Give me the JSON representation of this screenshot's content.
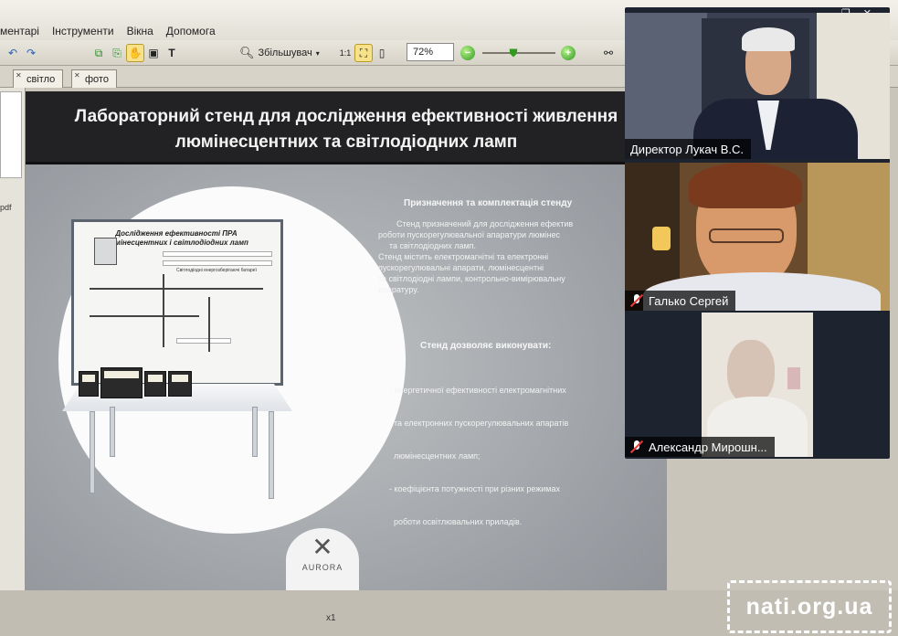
{
  "menu": {
    "items": [
      "ментарі",
      "Інструменти",
      "Вікна",
      "Допомога"
    ]
  },
  "toolbar": {
    "magnifier_label": "Збільшувач",
    "zoom_value": "72%"
  },
  "tabs": [
    {
      "label": "світло"
    },
    {
      "label": "фото"
    }
  ],
  "left_panel": {
    "file_label": "pdf"
  },
  "slide": {
    "title_line1": "Лабораторний стенд для дослідження ефективності живлення",
    "title_line2": "люмінесцентних та світлодіодних ламп",
    "board_title_line1": "Дослідження ефективності ПРА",
    "board_title_line2": "люмінесцентних і світлодіодних ламп",
    "board_sub": "Світлодіодні енергозберігаючі батареї",
    "section1_title": "Призначення та комплектація стенду",
    "section1_lines": [
      "Стенд призначений для дослідження ефектив",
      "роботи пускорегулювальної апаратури люмінес",
      "та світлодіодних ламп.",
      "Стенд містить електромагнітні та електронні",
      "пускорегулювальні апарати, люмінесцентні",
      "та світлодіодні лампи, контрольно-вимірювальну",
      "апаратуру."
    ],
    "section2_title": "Стенд дозволяє виконувати:",
    "section2_lines": [
      "- енергетичної ефективності електромагнітних",
      "  та електронних пускорегулювальних апаратів",
      "  люмінесцентних ламп;",
      "- коефіцієнта потужності при різних режимах",
      "  роботи освітлювальних приладів."
    ],
    "logo_text": "AURORA"
  },
  "page_indicator": "x1",
  "video": {
    "participants": [
      {
        "name": "Директор Лукач В.С.",
        "muted": false
      },
      {
        "name": "Галько Сергей",
        "muted": true
      },
      {
        "name": "Александр Мирошн...",
        "muted": true
      }
    ]
  },
  "watermark": "nati.org.ua"
}
